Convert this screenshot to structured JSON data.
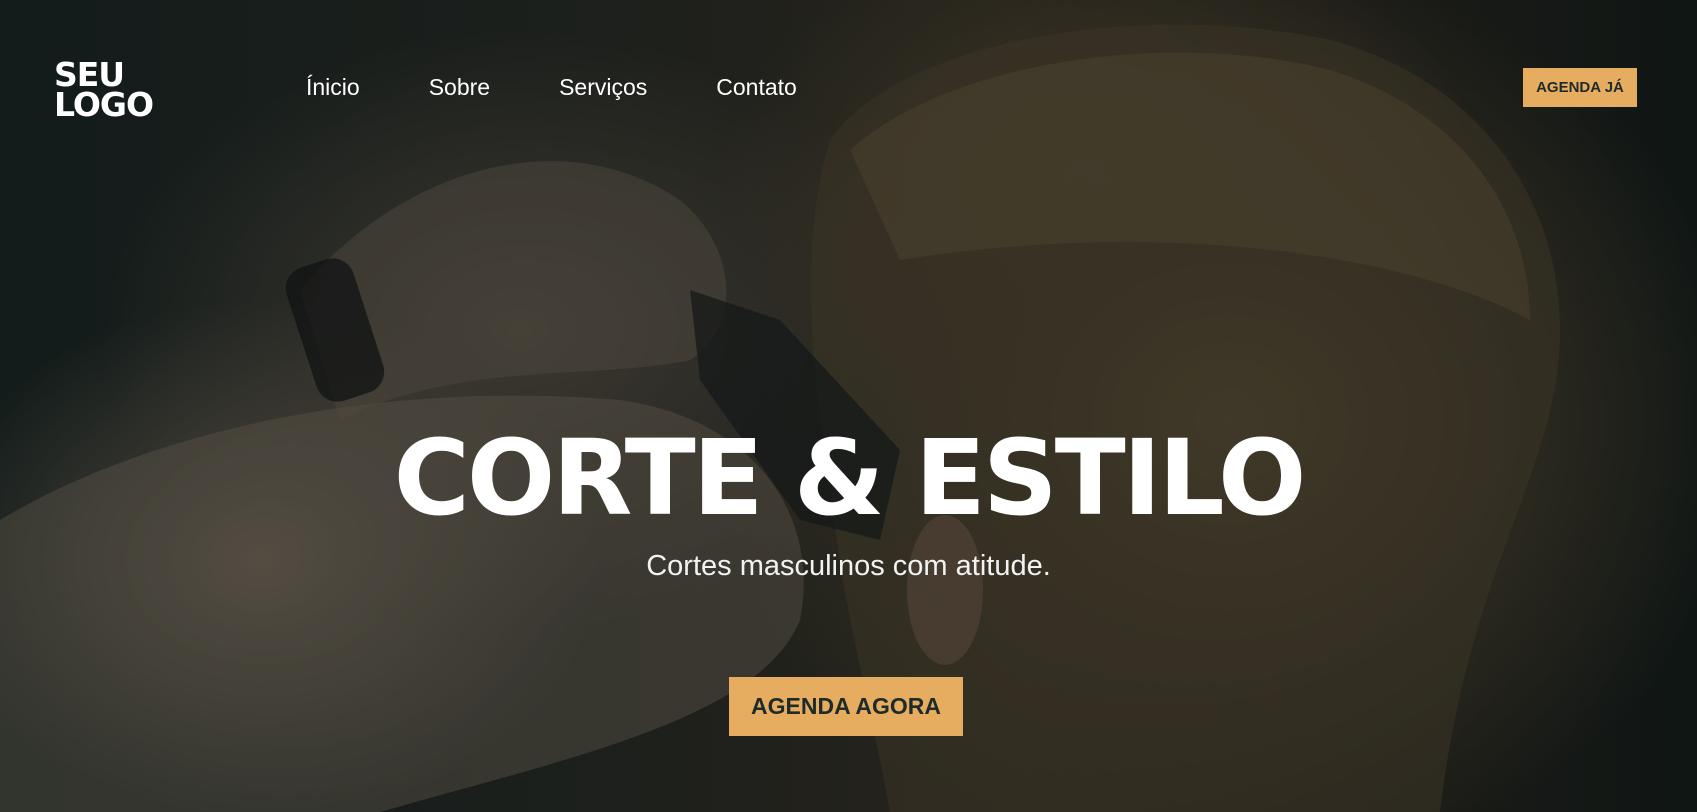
{
  "header": {
    "logo_line1": "SEU",
    "logo_line2": "LOGO",
    "nav": [
      {
        "label": "Ínicio"
      },
      {
        "label": "Sobre"
      },
      {
        "label": "Serviços"
      },
      {
        "label": "Contato"
      }
    ],
    "cta_label": "AGENDA JÁ"
  },
  "hero": {
    "headline": "CORTE & ESTILO",
    "subtitle": "Cortes masculinos com atitude.",
    "cta_label": "AGENDA AGORA",
    "background_image": "barber-cutting-hair-photo"
  },
  "colors": {
    "accent": "#e6ad60",
    "button_text": "#1f2a2a",
    "text": "#ffffff",
    "overlay": "#081010"
  }
}
